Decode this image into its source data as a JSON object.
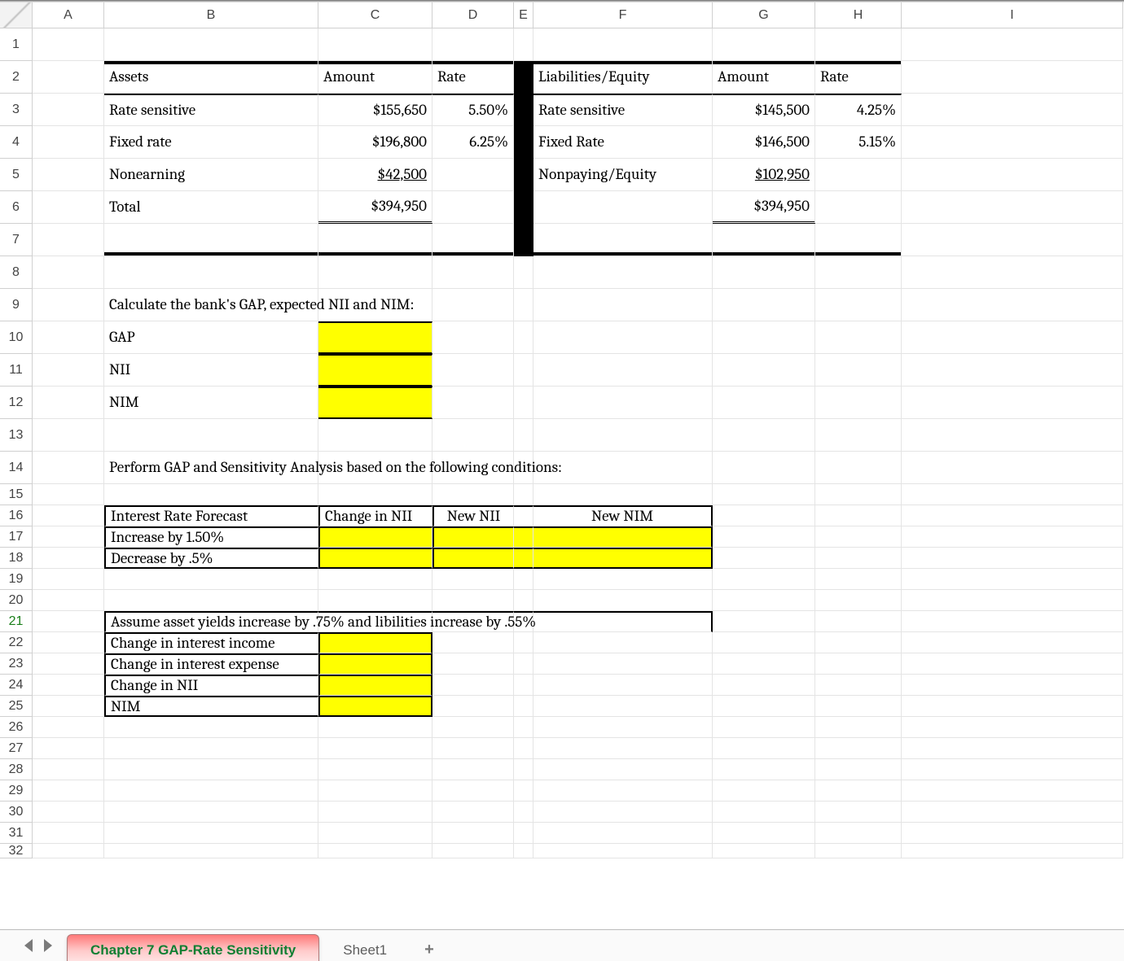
{
  "columns": [
    "A",
    "B",
    "C",
    "D",
    "E",
    "F",
    "G",
    "H",
    "I"
  ],
  "rows": {
    "labels": [
      "1",
      "2",
      "3",
      "4",
      "5",
      "6",
      "7",
      "8",
      "9",
      "10",
      "11",
      "12",
      "13",
      "14",
      "15",
      "16",
      "17",
      "18",
      "19",
      "20",
      "21",
      "22",
      "23",
      "24",
      "25",
      "26",
      "27",
      "28",
      "29",
      "30",
      "31",
      "32"
    ],
    "active": "21"
  },
  "table1": {
    "assets_header": "Assets",
    "amount_header_left": "Amount",
    "rate_header_left": "Rate",
    "liab_header": "Liabilities/Equity",
    "amount_header_right": "Amount",
    "rate_header_right": "Rate",
    "rows": {
      "r3": {
        "b": "Rate sensitive",
        "c": "$155,650",
        "d": "5.50%",
        "f": "Rate sensitive",
        "g": "$145,500",
        "h": "4.25%"
      },
      "r4": {
        "b": "Fixed  rate",
        "c": "$196,800",
        "d": "6.25%",
        "f": "Fixed Rate",
        "g": "$146,500",
        "h": "5.15%"
      },
      "r5": {
        "b": "Nonearning",
        "c": "$42,500",
        "f": "Nonpaying/Equity",
        "g": "$102,950"
      },
      "r6": {
        "b": "Total",
        "c": "$394,950",
        "g": "$394,950"
      }
    }
  },
  "section2": {
    "title": "Calculate the bank's GAP, expected NII and NIM:",
    "gap": "GAP",
    "nii": "NII",
    "nim": "NIM"
  },
  "section3": {
    "title": "Perform GAP and Sensitivity Analysis based on the following conditions:",
    "h16_b": "Interest Rate Forecast",
    "h16_c": "Change in NII",
    "h16_d": "New NII",
    "h16_f": "New NIM",
    "r17_b": "Increase by 1.50%",
    "r18_b": "Decrease by .5%"
  },
  "section4": {
    "title": "Assume asset yields increase by .75% and libilities increase by .55%",
    "r22": "Change in interest income",
    "r23": "Change in interest expense",
    "r24": "Change in NII",
    "r25": "NIM"
  },
  "tabs": {
    "active": "Chapter 7 GAP-Rate Sensitivity",
    "second": "Sheet1",
    "add": "+"
  }
}
